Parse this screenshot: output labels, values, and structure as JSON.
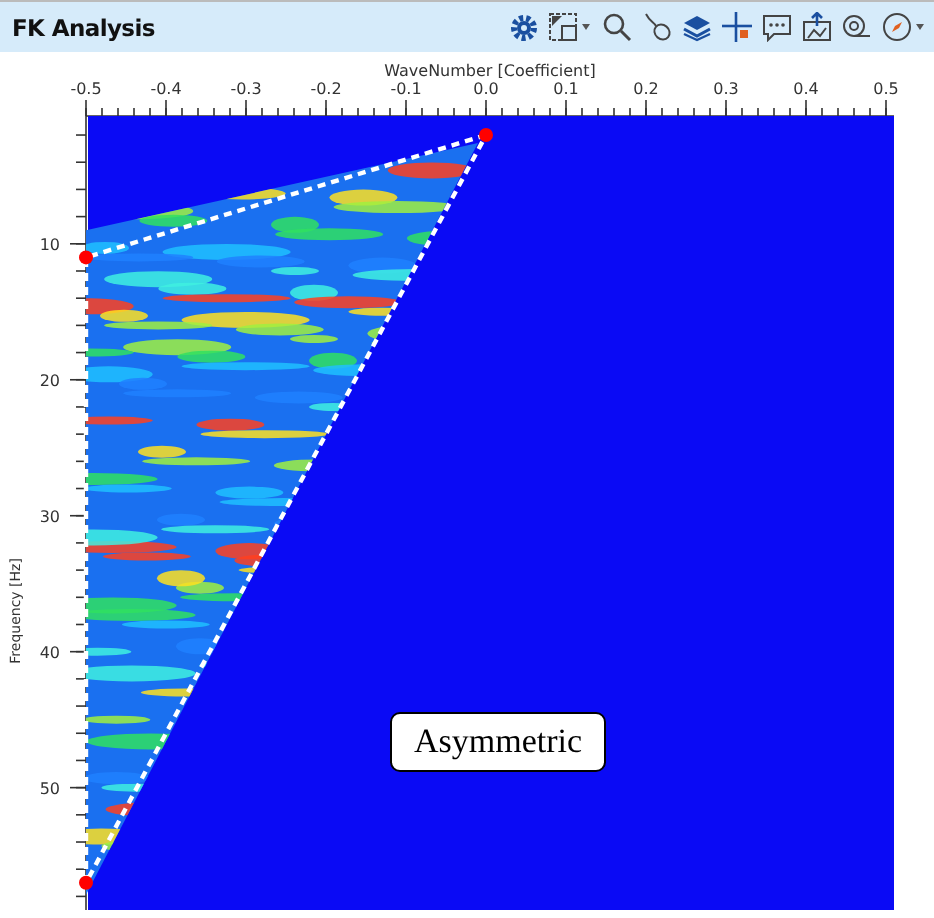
{
  "window": {
    "title": "FK Analysis"
  },
  "plot": {
    "x_axis": {
      "title": "WaveNumber [Coefficient]",
      "ticks": [
        "-0.5",
        "-0.4",
        "-0.3",
        "-0.2",
        "-0.1",
        "0.0",
        "0.1",
        "0.2",
        "0.3",
        "0.4",
        "0.5"
      ]
    },
    "y_axis": {
      "title": "Frequency [Hz]",
      "ticks": [
        "10",
        "20",
        "30",
        "40",
        "50"
      ]
    },
    "annotation": "Asymmetric"
  }
}
